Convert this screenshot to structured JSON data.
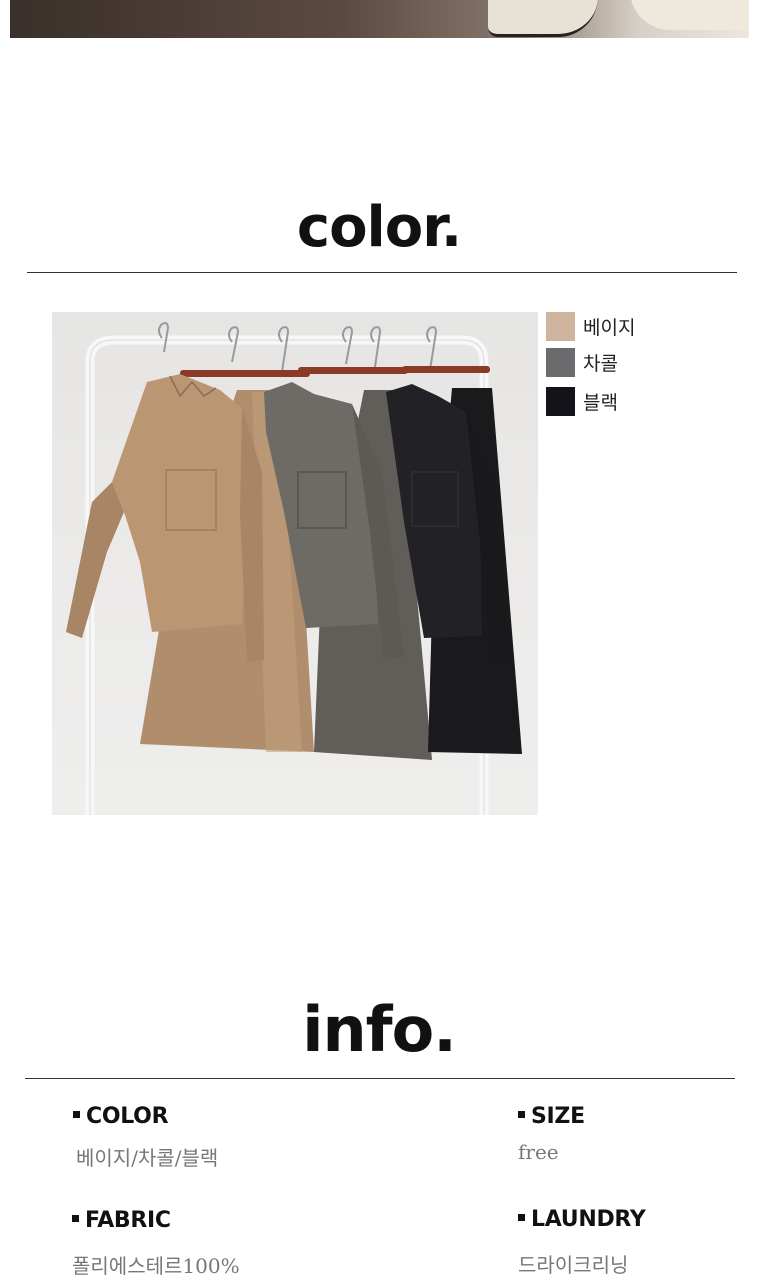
{
  "color_section": {
    "title": "color.",
    "swatches": [
      {
        "label": "베이지",
        "color": "#cfb49d"
      },
      {
        "label": "차콜",
        "color": "#6b6a6c"
      },
      {
        "label": "블랙",
        "color": "#141319"
      }
    ]
  },
  "info_section": {
    "title": "info.",
    "items": [
      {
        "key": "COLOR",
        "value": "베이지/차콜/블랙"
      },
      {
        "key": "SIZE",
        "value": "free"
      },
      {
        "key": "FABRIC",
        "value": "폴리에스테르100%"
      },
      {
        "key": "LAUNDRY",
        "value": "드라이크리닝"
      }
    ]
  },
  "colors": {
    "beige": "#b8946f",
    "charcoal": "#66625f",
    "black": "#1b1b1d",
    "rail": "#f4f4f4",
    "hanger_wood": "#8a3a25"
  }
}
